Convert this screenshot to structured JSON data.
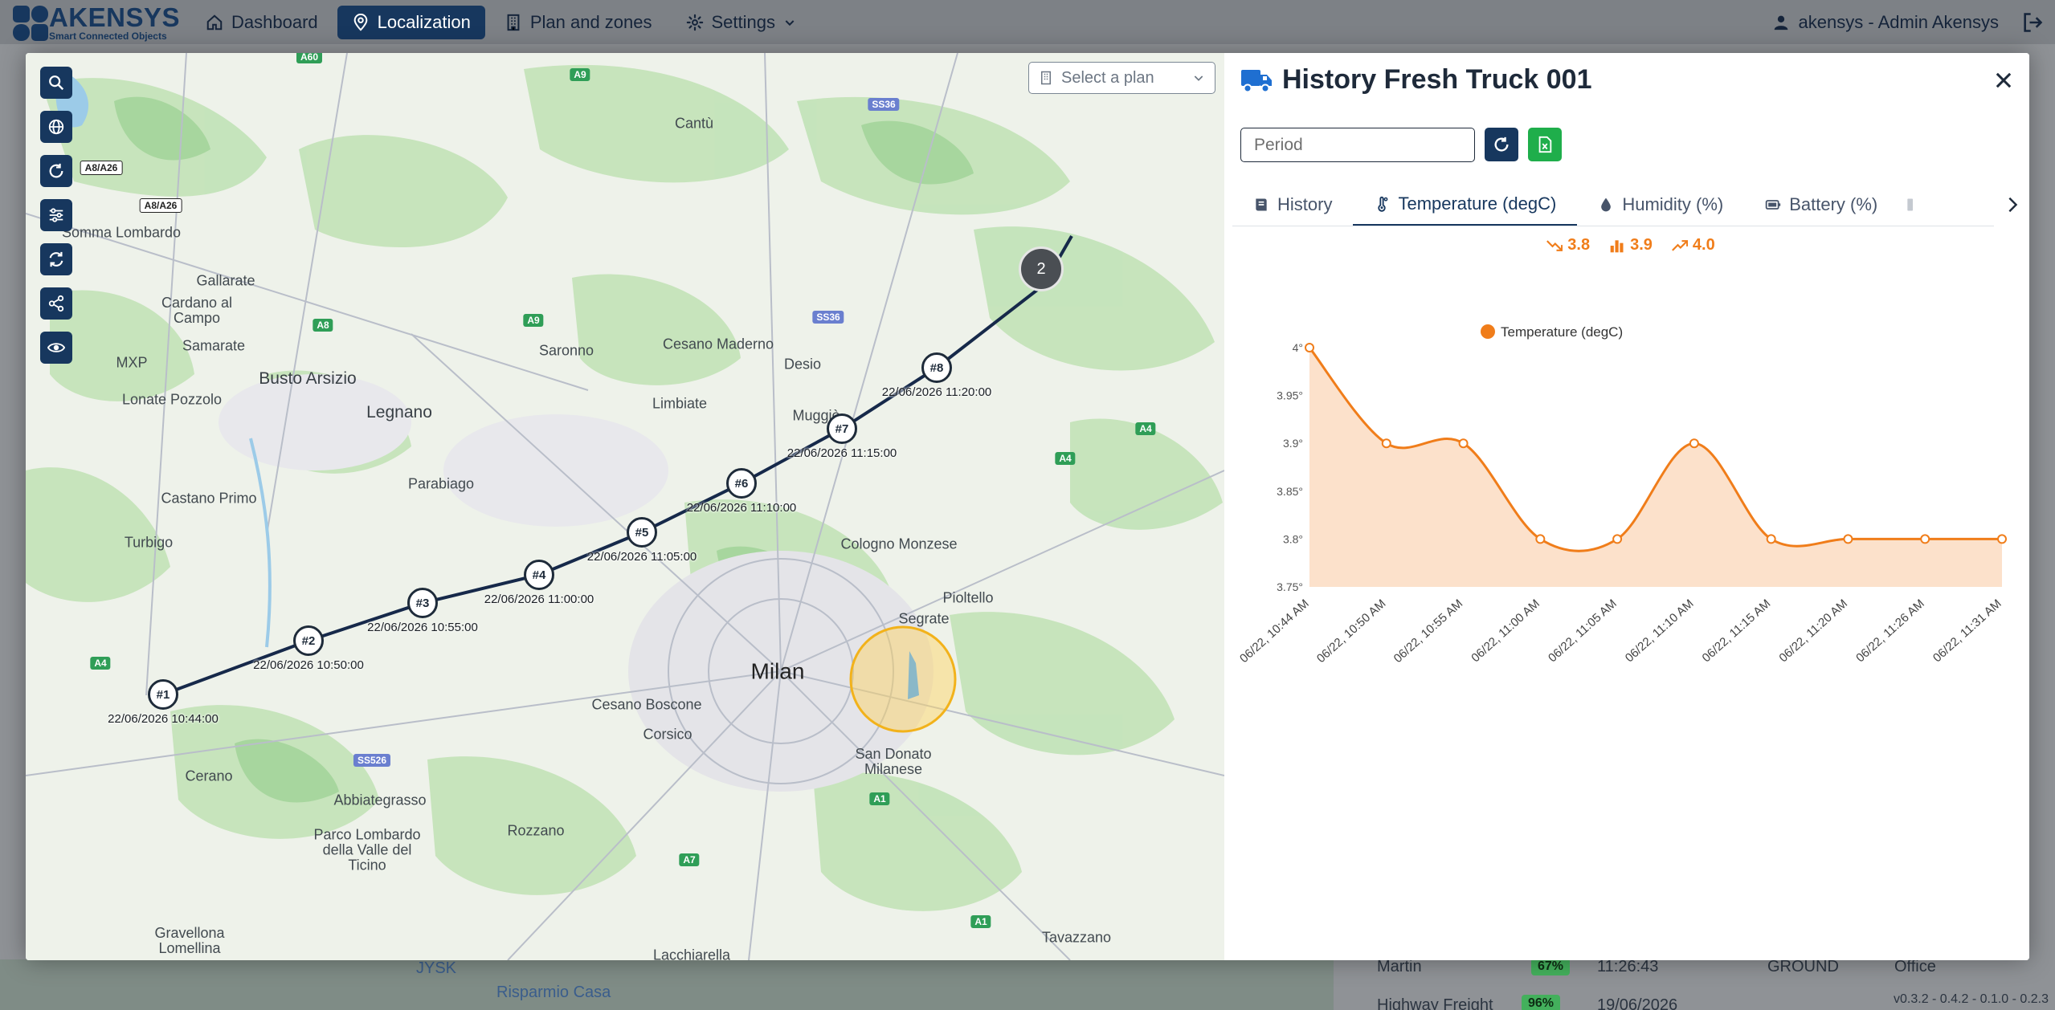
{
  "app": {
    "logo": {
      "name": "AKENSYS",
      "tagline": "Smart Connected Objects"
    },
    "nav": [
      {
        "label": "Dashboard",
        "icon": "home-icon",
        "active": false
      },
      {
        "label": "Localization",
        "icon": "location-pin-icon",
        "active": true
      },
      {
        "label": "Plan and zones",
        "icon": "building-icon",
        "active": false
      },
      {
        "label": "Settings",
        "icon": "gear-icon",
        "active": false
      }
    ],
    "user": "akensys - Admin Akensys",
    "version": "v0.3.2 - 0.4.2 - 0.1.0 - 0.2.3"
  },
  "background": {
    "rows": [
      {
        "name": "Martin",
        "battery": "67%",
        "time": "11:26:43",
        "floor": "GROUND",
        "zone": "Office"
      },
      {
        "name": "Highway Freight",
        "battery": "96%",
        "time": "19/06/2026"
      }
    ],
    "map_labels": [
      "JYSK",
      "Risparmio Casa"
    ]
  },
  "map": {
    "plan_select": {
      "placeholder": "Select a plan"
    },
    "places": [
      {
        "text": "Cantù",
        "cls": "small"
      },
      {
        "text": "Somma Lombardo",
        "cls": "small"
      },
      {
        "text": "Gallarate",
        "cls": "small"
      },
      {
        "text": "Cardano al Campo",
        "cls": "small"
      },
      {
        "text": "Samarate",
        "cls": "small"
      },
      {
        "text": "MXP",
        "cls": "small"
      },
      {
        "text": "Busto Arsizio",
        "cls": "big"
      },
      {
        "text": "Legnano",
        "cls": "big"
      },
      {
        "text": "Lonate Pozzolo",
        "cls": "small"
      },
      {
        "text": "Saronno",
        "cls": "small"
      },
      {
        "text": "Cesano Maderno",
        "cls": "small"
      },
      {
        "text": "Desio",
        "cls": "small"
      },
      {
        "text": "Limbiate",
        "cls": "small"
      },
      {
        "text": "Parabiago",
        "cls": "small"
      },
      {
        "text": "Castano Primo",
        "cls": "small"
      },
      {
        "text": "Turbigo",
        "cls": "small"
      },
      {
        "text": "Cologno Monzese",
        "cls": "small"
      },
      {
        "text": "Pioltello",
        "cls": "small"
      },
      {
        "text": "Segrate",
        "cls": "small"
      },
      {
        "text": "Milan",
        "cls": "city"
      },
      {
        "text": "Cesano Boscone",
        "cls": "small"
      },
      {
        "text": "Corsico",
        "cls": "small"
      },
      {
        "text": "San Donato Milanese",
        "cls": "small"
      },
      {
        "text": "Cerano",
        "cls": "small"
      },
      {
        "text": "Abbiategrasso",
        "cls": "small"
      },
      {
        "text": "Parco Lombardo della Valle del Ticino",
        "cls": "small"
      },
      {
        "text": "Rozzano",
        "cls": "small"
      },
      {
        "text": "Gravellona Lomellina",
        "cls": "small"
      },
      {
        "text": "Lacchiarella",
        "cls": "small"
      },
      {
        "text": "Tavazzano",
        "cls": "small"
      },
      {
        "text": "Muggiò",
        "cls": "small"
      }
    ],
    "roads": [
      "A60",
      "A9",
      "SS36",
      "A8/A26",
      "A8/A26",
      "A8",
      "A9",
      "SS36",
      "A4",
      "A4",
      "A4",
      "SS526",
      "A1",
      "A7",
      "A1"
    ],
    "stops": [
      {
        "label": "#1",
        "time": "22/06/2026 10:44:00"
      },
      {
        "label": "#2",
        "time": "22/06/2026 10:50:00"
      },
      {
        "label": "#3",
        "time": "22/06/2026 10:55:00"
      },
      {
        "label": "#4",
        "time": "22/06/2026 11:00:00"
      },
      {
        "label": "#5",
        "time": "22/06/2026 11:05:00"
      },
      {
        "label": "#6",
        "time": "22/06/2026 11:10:00"
      },
      {
        "label": "#7",
        "time": "22/06/2026 11:15:00"
      },
      {
        "label": "#8",
        "time": "22/06/2026 11:20:00"
      }
    ],
    "cluster": {
      "count": "2"
    }
  },
  "panel": {
    "title": "History Fresh Truck 001",
    "period_placeholder": "Period",
    "tabs": [
      {
        "label": "History",
        "icon": "book-icon",
        "active": false
      },
      {
        "label": "Temperature (degC)",
        "icon": "thermometer-icon",
        "active": true
      },
      {
        "label": "Humidity (%)",
        "icon": "droplet-icon",
        "active": false
      },
      {
        "label": "Battery (%)",
        "icon": "battery-icon",
        "active": false
      }
    ],
    "stats": {
      "min": "3.8",
      "avg": "3.9",
      "max": "4.0"
    }
  },
  "chart_data": {
    "type": "area",
    "series": [
      {
        "name": "Temperature (degC)",
        "color": "#f07d1a",
        "values": [
          4.0,
          3.9,
          3.9,
          3.8,
          3.8,
          3.9,
          3.8,
          3.8,
          3.8,
          3.8
        ]
      }
    ],
    "categories": [
      "06/22, 10:44 AM",
      "06/22, 10:50 AM",
      "06/22, 10:55 AM",
      "06/22, 11:00 AM",
      "06/22, 11:05 AM",
      "06/22, 11:10 AM",
      "06/22, 11:15 AM",
      "06/22, 11:20 AM",
      "06/22, 11:26 AM",
      "06/22, 11:31 AM"
    ],
    "yticks": [
      "3.75°",
      "3.8°",
      "3.85°",
      "3.9°",
      "3.95°",
      "4°"
    ],
    "ylim": [
      3.75,
      4.0
    ],
    "legend": "top"
  }
}
